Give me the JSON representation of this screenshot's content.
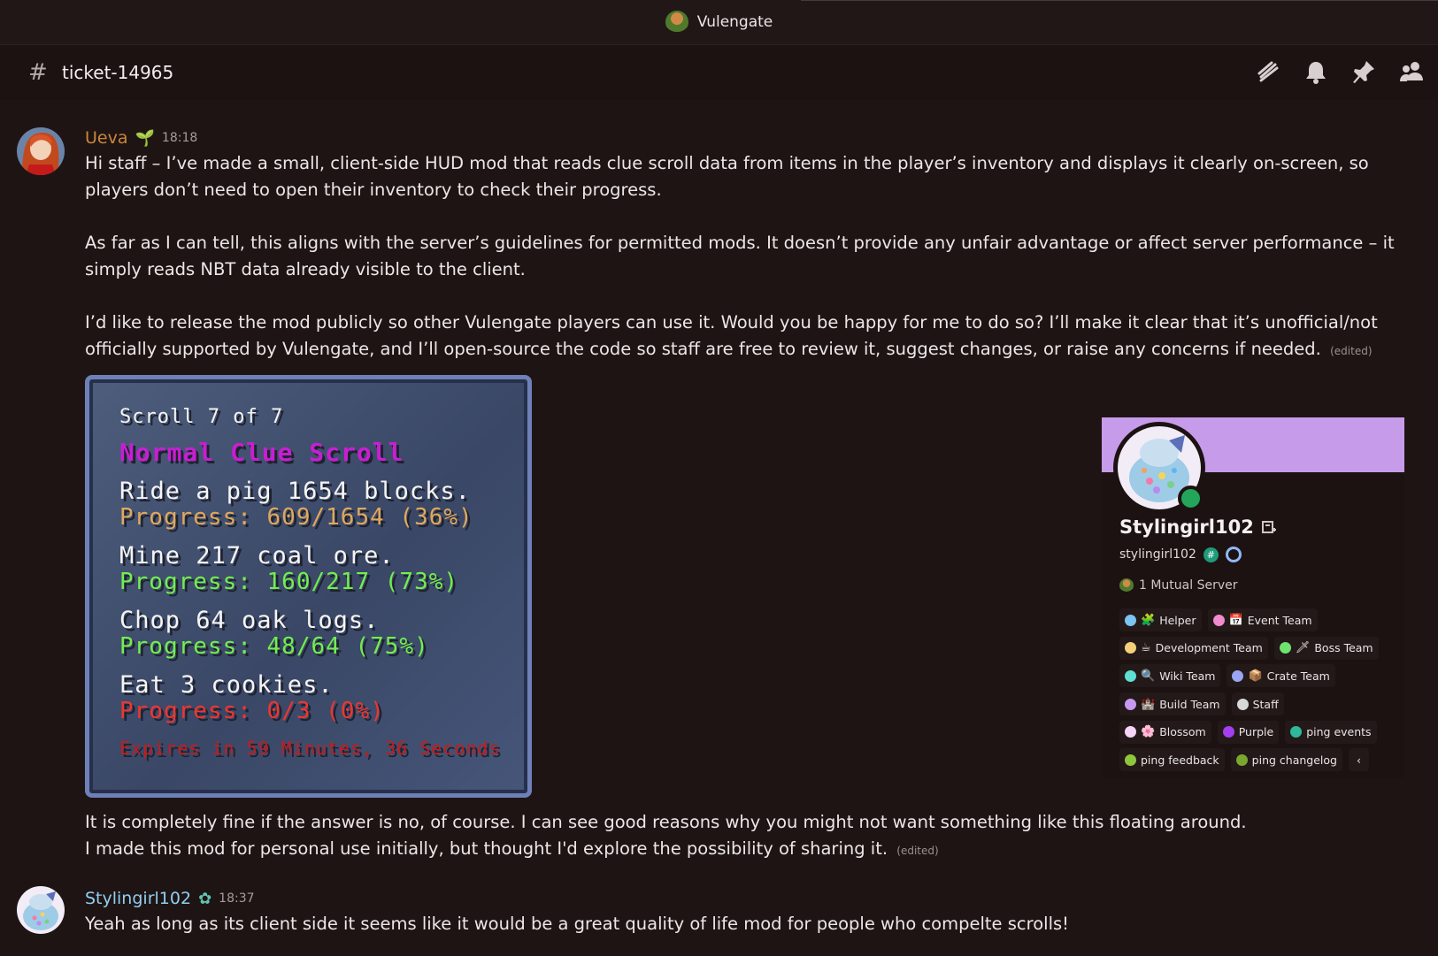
{
  "window": {
    "title": "Vulengate"
  },
  "channel": {
    "name": "ticket-14965"
  },
  "header_icons": [
    "threads-icon",
    "bell-icon",
    "pin-icon",
    "members-icon"
  ],
  "messages": [
    {
      "author": "Ueva",
      "author_color": "#c9873a",
      "badge": "🌱",
      "time": "18:18",
      "paragraphs": [
        "Hi staff – I’ve made a small, client-side HUD mod that reads clue scroll data from items in the player’s inventory and displays it clearly on-screen, so players don’t need to open their inventory to check their progress.",
        "As far as I can tell, this aligns with the server’s guidelines for permitted mods. It doesn’t provide any unfair advantage or affect server performance – it simply reads NBT data already visible to the client.",
        "I’d like to release the mod publicly so other Vulengate players can use it. Would you be happy for me to do so? I’ll make it clear that it’s unofficial/not officially supported by Vulengate, and I’ll open-source the code so staff are free to review it, suggest changes, or raise any concerns if needed."
      ],
      "edited_label": "(edited)",
      "followup": [
        "It is completely fine if the answer is no, of course. I can see good reasons why you might not want something like this floating around.",
        "I made this mod for personal use initially, but thought I'd explore the possibility of sharing it."
      ],
      "followup_edited_label": "(edited)"
    },
    {
      "author": "Stylingirl102",
      "author_color": "#8fcff0",
      "badge": "✿",
      "time": "18:37",
      "text": "Yeah as long as its client side it seems like it would be a great quality of life mod for people who compelte scrolls!"
    }
  ],
  "attachment": {
    "scroll_header": "Scroll 7 of 7",
    "scroll_type": "Normal Clue Scroll",
    "tasks": [
      {
        "task": "Ride a pig 1654 blocks.",
        "progress": "Progress: 609/1654 (36%)",
        "color": "#e0a85c"
      },
      {
        "task": "Mine 217 coal ore.",
        "progress": "Progress: 160/217 (73%)",
        "color": "#72ee4e"
      },
      {
        "task": "Chop 64 oak logs.",
        "progress": "Progress: 48/64 (75%)",
        "color": "#72ee4e"
      },
      {
        "task": "Eat 3 cookies.",
        "progress": "Progress: 0/3 (0%)",
        "color": "#f0352f"
      }
    ],
    "expires": "Expires in 59 Minutes, 36 Seconds"
  },
  "profile_card": {
    "display_name": "Stylingirl102",
    "username": "stylingirl102",
    "mutual_servers": "1 Mutual Server",
    "banner_color": "#c69be9",
    "status": "online",
    "roles": [
      [
        {
          "name": "Helper",
          "color": "#7cc4f2",
          "emoji": "🧩"
        },
        {
          "name": "Event Team",
          "color": "#f28ad0",
          "emoji": "📅"
        }
      ],
      [
        {
          "name": "Development Team",
          "color": "#f5d07a",
          "emoji": "☕"
        },
        {
          "name": "Boss Team",
          "color": "#6ee36e",
          "emoji": "🗡"
        }
      ],
      [
        {
          "name": "Wiki Team",
          "color": "#5fe0d4",
          "emoji": "🔍"
        },
        {
          "name": "Crate Team",
          "color": "#9aa6f0",
          "emoji": "📦"
        }
      ],
      [
        {
          "name": "Build Team",
          "color": "#c79af0",
          "emoji": "🏰"
        },
        {
          "name": "Staff",
          "color": "#d8d8d8",
          "emoji": ""
        }
      ],
      [
        {
          "name": "Blossom",
          "color": "#f6d6f6",
          "emoji": "🌸"
        },
        {
          "name": "Purple",
          "color": "#a43ef0",
          "emoji": ""
        },
        {
          "name": "ping events",
          "color": "#2fb89a",
          "emoji": ""
        }
      ],
      [
        {
          "name": "ping feedback",
          "color": "#8ec63c",
          "emoji": ""
        },
        {
          "name": "ping changelog",
          "color": "#7aa82e",
          "emoji": ""
        },
        {
          "name": "‹",
          "color": "",
          "emoji": ""
        }
      ]
    ]
  }
}
